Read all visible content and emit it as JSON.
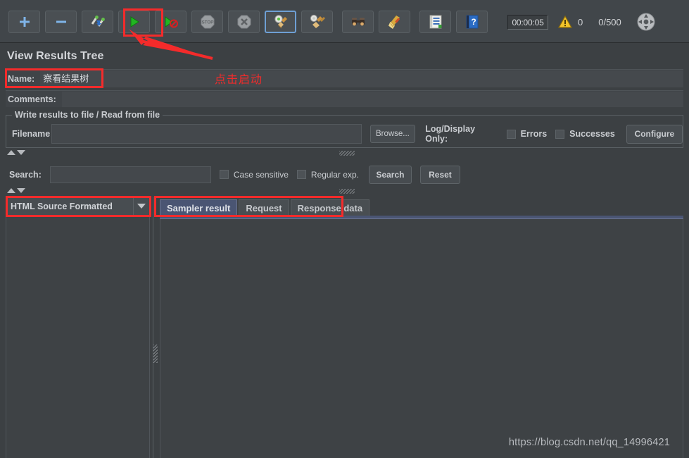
{
  "window": {
    "background_color": "#3c4043",
    "accent_color": "#4a5573",
    "annotation_color": "#f42b2b"
  },
  "toolbar": {
    "buttons": [
      {
        "name": "add-icon",
        "tooltip": "Add"
      },
      {
        "name": "remove-icon",
        "tooltip": "Remove"
      },
      {
        "name": "toggle-icon",
        "tooltip": "Toggle"
      },
      {
        "name": "start-icon",
        "tooltip": "Start"
      },
      {
        "name": "start-no-pauses-icon",
        "tooltip": "Start no pauses"
      },
      {
        "name": "stop-icon",
        "tooltip": "Stop"
      },
      {
        "name": "shutdown-icon",
        "tooltip": "Shutdown"
      },
      {
        "name": "clear-icon",
        "tooltip": "Clear"
      },
      {
        "name": "clear-all-icon",
        "tooltip": "Clear All"
      },
      {
        "name": "search-icon",
        "tooltip": "Search"
      },
      {
        "name": "search-reset-icon",
        "tooltip": "Reset Search"
      },
      {
        "name": "function-helper-icon",
        "tooltip": "Function Helper Dialog"
      },
      {
        "name": "help-icon",
        "tooltip": "Help"
      }
    ],
    "timer": "00:00:05",
    "warning_count": "0",
    "thread_count": "0/500",
    "end_button": "end-icon"
  },
  "page": {
    "title": "View Results Tree",
    "name_label": "Name:",
    "name_value": "察看结果树",
    "comments_label": "Comments:",
    "comments_value": ""
  },
  "write_results": {
    "group_title": "Write results to file / Read from file",
    "filename_label": "Filename",
    "filename_value": "",
    "browse_button": "Browse...",
    "log_display_label": "Log/Display Only:",
    "errors_label": "Errors",
    "errors_checked": false,
    "successes_label": "Successes",
    "successes_checked": false,
    "configure_button": "Configure"
  },
  "search_panel": {
    "search_label": "Search:",
    "search_value": "",
    "case_sensitive_label": "Case sensitive",
    "case_sensitive_checked": false,
    "regular_exp_label": "Regular exp.",
    "regular_exp_checked": false,
    "search_button": "Search",
    "reset_button": "Reset"
  },
  "results_view": {
    "renderer_selected": "HTML Source Formatted",
    "tabs": [
      {
        "label": "Sampler result",
        "active": true
      },
      {
        "label": "Request",
        "active": false
      },
      {
        "label": "Response data",
        "active": false
      }
    ]
  },
  "annotations": {
    "click_to_start_text": "点击启动"
  },
  "watermark": "https://blog.csdn.net/qq_14996421"
}
